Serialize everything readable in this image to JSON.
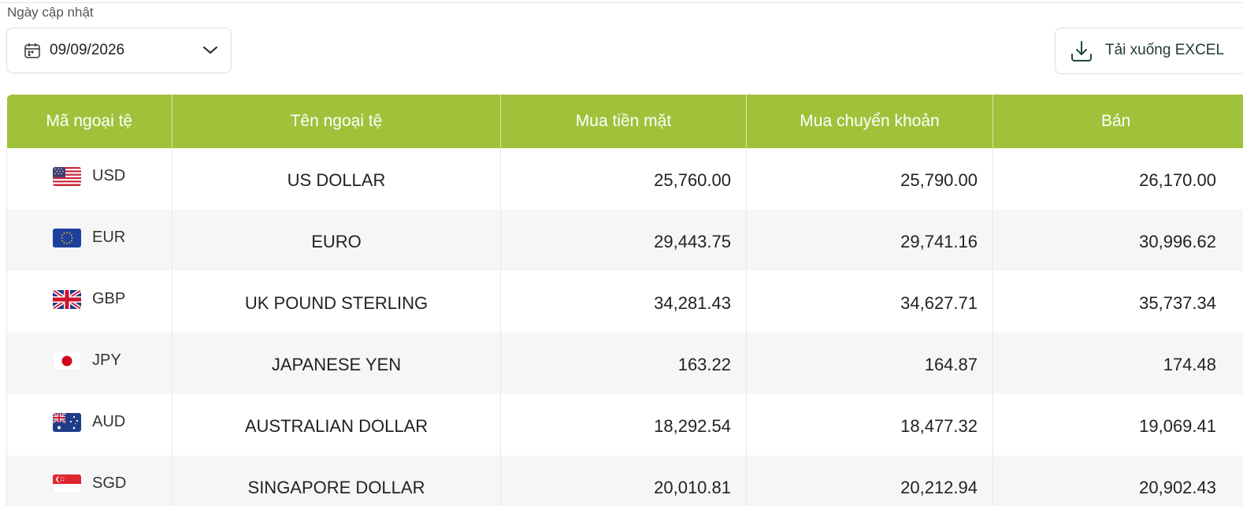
{
  "filter": {
    "label": "Ngày cập nhật",
    "date": "09/09/2026"
  },
  "download": {
    "label": "Tải xuống EXCEL"
  },
  "table": {
    "headers": [
      "Mã ngoại tệ",
      "Tên ngoại tệ",
      "Mua tiền mặt",
      "Mua chuyển khoản",
      "Bán"
    ],
    "rows": [
      {
        "code": "USD",
        "flag": "us-flag-icon",
        "name": "US DOLLAR",
        "cash_buy": "25,760.00",
        "transfer_buy": "25,790.00",
        "sell": "26,170.00"
      },
      {
        "code": "EUR",
        "flag": "eu-flag-icon",
        "name": "EURO",
        "cash_buy": "29,443.75",
        "transfer_buy": "29,741.16",
        "sell": "30,996.62"
      },
      {
        "code": "GBP",
        "flag": "uk-flag-icon",
        "name": "UK POUND STERLING",
        "cash_buy": "34,281.43",
        "transfer_buy": "34,627.71",
        "sell": "35,737.34"
      },
      {
        "code": "JPY",
        "flag": "japan-flag-icon",
        "name": "JAPANESE YEN",
        "cash_buy": "163.22",
        "transfer_buy": "164.87",
        "sell": "174.48"
      },
      {
        "code": "AUD",
        "flag": "australia-flag-icon",
        "name": "AUSTRALIAN DOLLAR",
        "cash_buy": "18,292.54",
        "transfer_buy": "18,477.32",
        "sell": "19,069.41"
      },
      {
        "code": "SGD",
        "flag": "singapore-flag-icon",
        "name": "SINGAPORE DOLLAR",
        "cash_buy": "20,010.81",
        "transfer_buy": "20,212.94",
        "sell": "20,902.43"
      }
    ]
  },
  "colors": {
    "header_bg": "#a0c23a",
    "header_text": "#ffffff",
    "row_alt_bg": "#f6f6f6"
  }
}
